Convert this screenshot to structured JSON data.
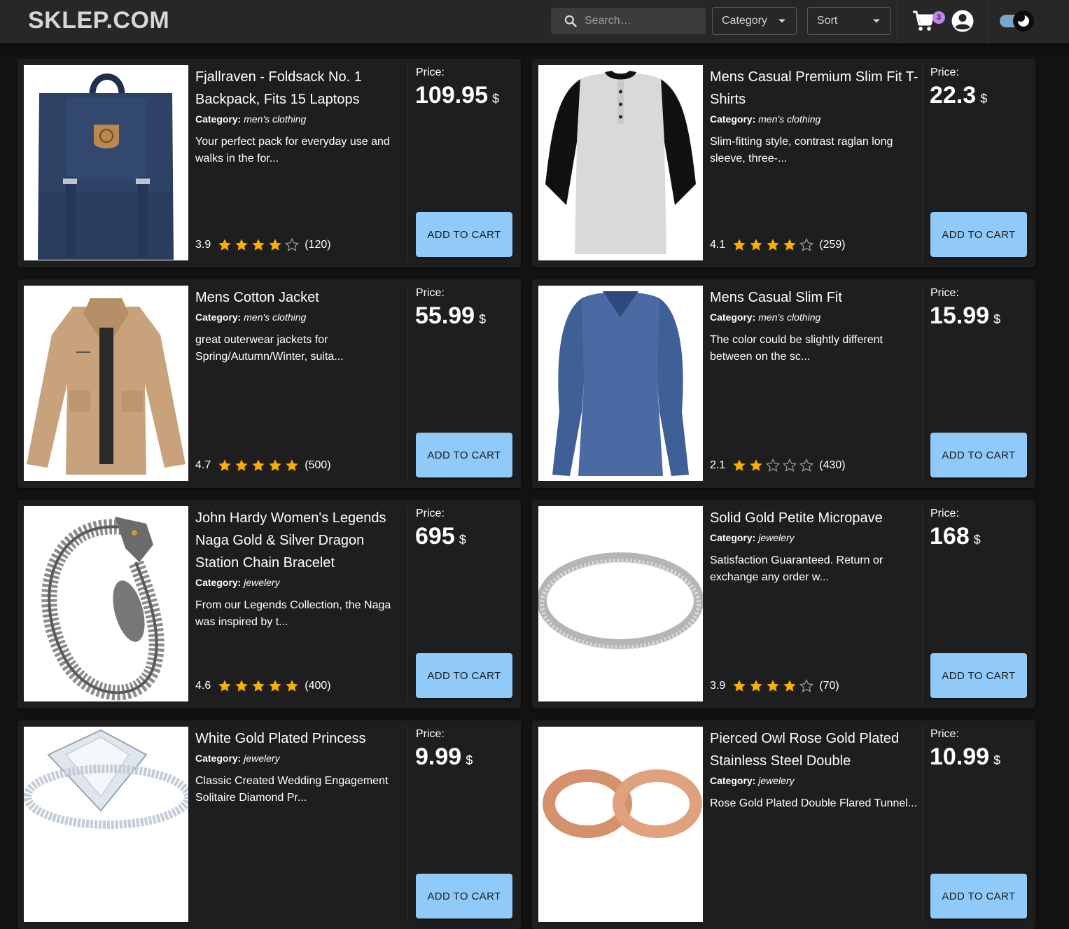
{
  "header": {
    "logo": "SKLEP.COM",
    "search_placeholder": "Search…",
    "category_label": "Category",
    "sort_label": "Sort",
    "cart_count": "3"
  },
  "labels": {
    "price": "Price:",
    "currency": "$",
    "add_to_cart": "ADD TO CART",
    "category_prefix": "Category:"
  },
  "colors": {
    "accent": "#90caf9",
    "star": "#faaf00",
    "badge": "#c084e8"
  },
  "products": [
    {
      "title": "Fjallraven - Foldsack No. 1 Backpack, Fits 15 Laptops",
      "category": "men's clothing",
      "description": "Your perfect pack for everyday use and walks in the for...",
      "price": "109.95",
      "rating": "3.9",
      "rating_value": 3.9,
      "count": "(120)",
      "image": "backpack"
    },
    {
      "title": "Mens Casual Premium Slim Fit T-Shirts",
      "category": "men's clothing",
      "description": "Slim-fitting style, contrast raglan long sleeve, three-...",
      "price": "22.3",
      "rating": "4.1",
      "rating_value": 4.1,
      "count": "(259)",
      "image": "raglan-shirt"
    },
    {
      "title": "Mens Cotton Jacket",
      "category": "men's clothing",
      "description": "great outerwear jackets for Spring/Autumn/Winter, suita...",
      "price": "55.99",
      "rating": "4.7",
      "rating_value": 4.7,
      "count": "(500)",
      "image": "jacket"
    },
    {
      "title": "Mens Casual Slim Fit",
      "category": "men's clothing",
      "description": "The color could be slightly different between on the sc...",
      "price": "15.99",
      "rating": "2.1",
      "rating_value": 2.1,
      "count": "(430)",
      "image": "long-sleeve-shirt"
    },
    {
      "title": "John Hardy Women's Legends Naga Gold & Silver Dragon Station Chain Bracelet",
      "category": "jewelery",
      "description": "From our Legends Collection, the Naga was inspired by t...",
      "price": "695",
      "rating": "4.6",
      "rating_value": 4.6,
      "count": "(400)",
      "image": "bracelet"
    },
    {
      "title": "Solid Gold Petite Micropave",
      "category": "jewelery",
      "description": "Satisfaction Guaranteed. Return or exchange any order w...",
      "price": "168",
      "rating": "3.9",
      "rating_value": 3.9,
      "count": "(70)",
      "image": "ring"
    },
    {
      "title": "White Gold Plated Princess",
      "category": "jewelery",
      "description": "Classic Created Wedding Engagement Solitaire Diamond Pr...",
      "price": "9.99",
      "rating": "",
      "rating_value": 0,
      "count": "",
      "image": "diamond-ring"
    },
    {
      "title": "Pierced Owl Rose Gold Plated Stainless Steel Double",
      "category": "jewelery",
      "description": "Rose Gold Plated Double Flared Tunnel...",
      "price": "10.99",
      "rating": "",
      "rating_value": 0,
      "count": "",
      "image": "tunnel-plugs"
    }
  ]
}
